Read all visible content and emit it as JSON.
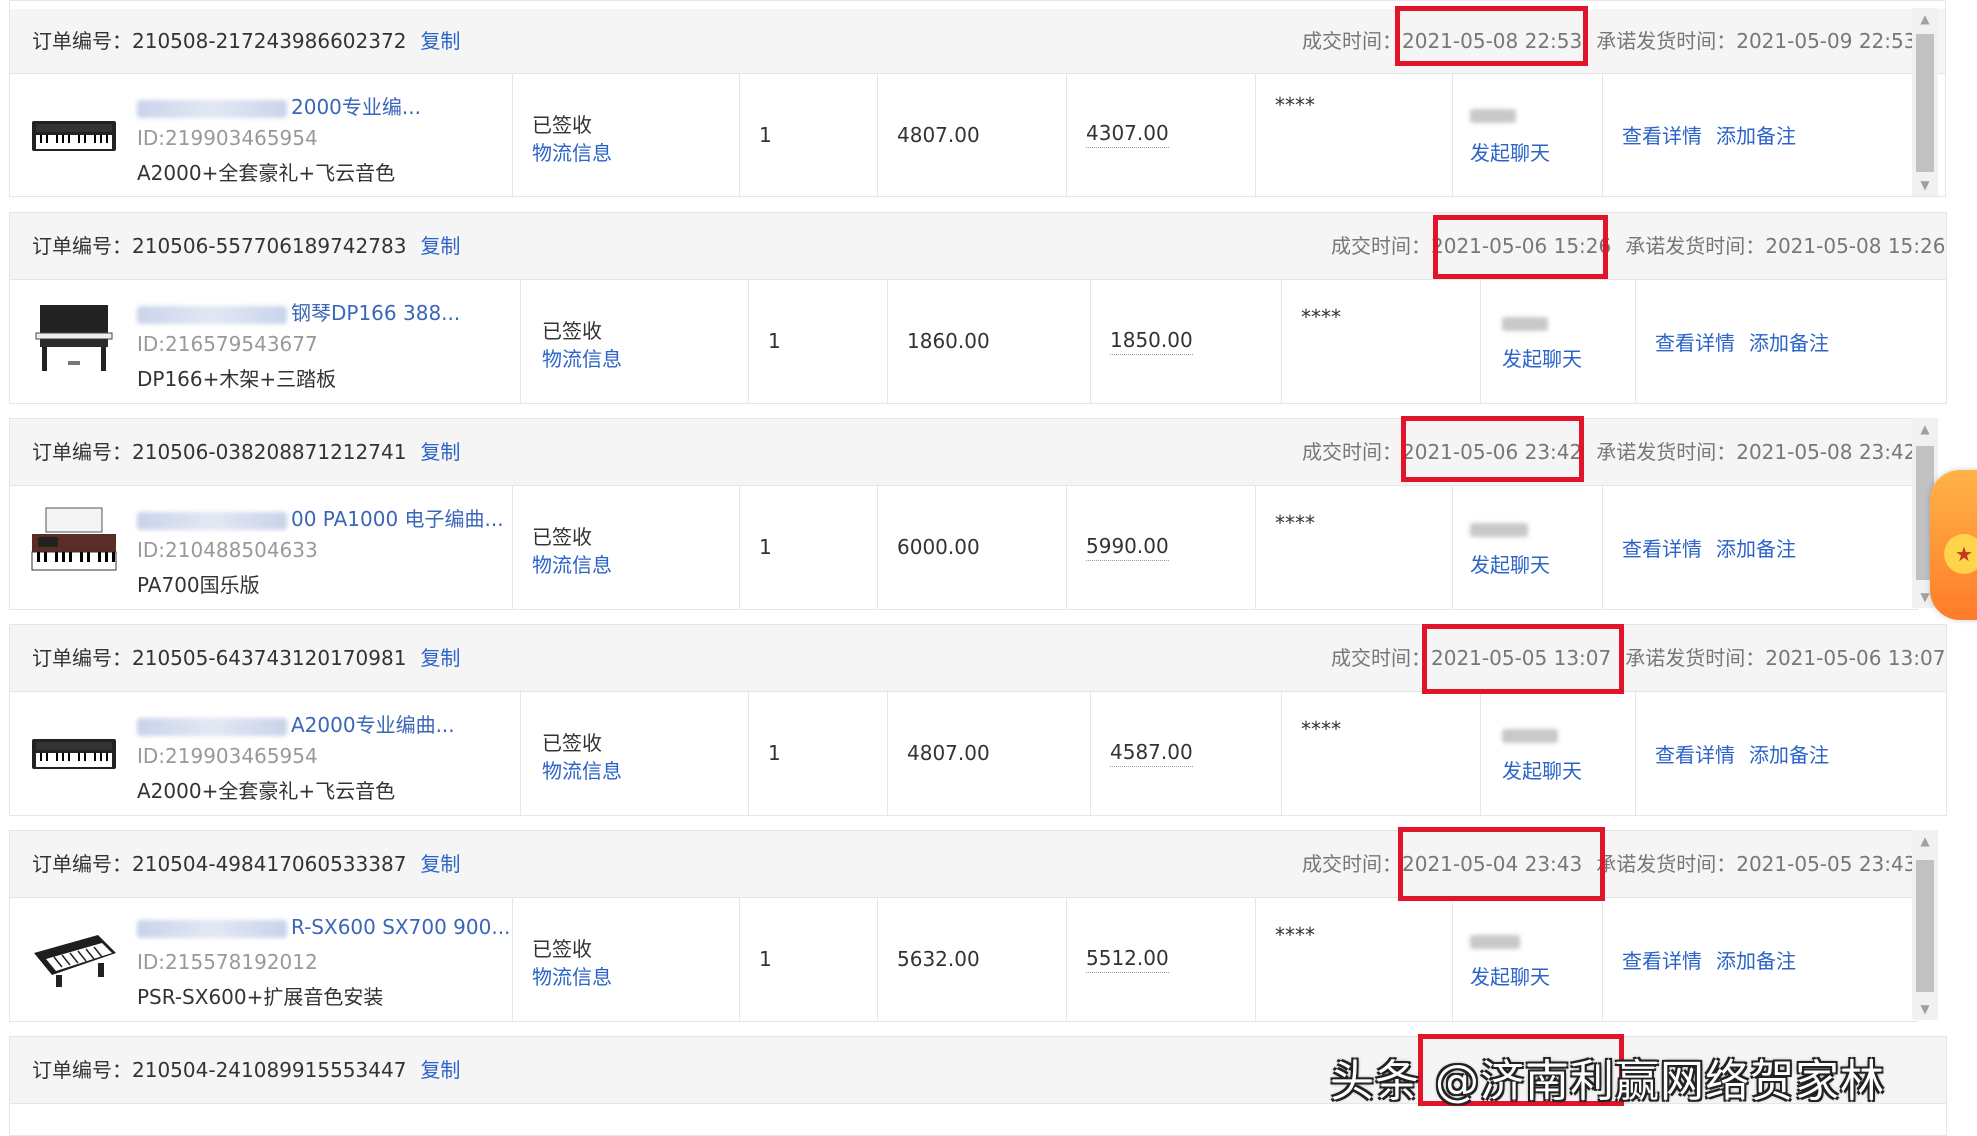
{
  "labels": {
    "order_no": "订单编号：",
    "copy": "复制",
    "deal_time": "成交时间：",
    "promise_time": "承诺发货时间：",
    "signed": "已签收",
    "logistics": "物流信息",
    "chat": "发起聊天",
    "details": "查看详情",
    "note": "添加备注",
    "masked": "****"
  },
  "orders": [
    {
      "order_no": "210508-217243986602372",
      "deal_time": "2021-05-08 22:53",
      "promise_time": "2021-05-09 22:53",
      "title": "2000专业编...",
      "item_id": "ID:219903465954",
      "spec": "A2000+全套豪礼+飞云音色",
      "qty": "1",
      "price": "4807.00",
      "paid": "4307.00"
    },
    {
      "order_no": "210506-557706189742783",
      "deal_time": "2021-05-06 15:26",
      "promise_time": "2021-05-08 15:26",
      "title": "钢琴DP166 388...",
      "item_id": "ID:216579543677",
      "spec": "DP166+木架+三踏板",
      "qty": "1",
      "price": "1860.00",
      "paid": "1850.00"
    },
    {
      "order_no": "210506-038208871212741",
      "deal_time": "2021-05-06 23:42",
      "promise_time": "2021-05-08 23:42",
      "title": "00 PA1000 电子编曲...",
      "item_id": "ID:210488504633",
      "spec": "PA700国乐版",
      "qty": "1",
      "price": "6000.00",
      "paid": "5990.00"
    },
    {
      "order_no": "210505-643743120170981",
      "deal_time": "2021-05-05 13:07",
      "promise_time": "2021-05-06 13:07",
      "title": "A2000专业编曲...",
      "item_id": "ID:219903465954",
      "spec": "A2000+全套豪礼+飞云音色",
      "qty": "1",
      "price": "4807.00",
      "paid": "4587.00"
    },
    {
      "order_no": "210504-498417060533387",
      "deal_time": "2021-05-04 23:43",
      "promise_time": "2021-05-05 23:43",
      "title": "R-SX600 SX700 900...",
      "item_id": "ID:215578192012",
      "spec": "PSR-SX600+扩展音色安装",
      "qty": "1",
      "price": "5632.00",
      "paid": "5512.00"
    },
    {
      "order_no": "210504-241089915553447"
    }
  ],
  "watermark": "头条 @济南利赢网络贺家林",
  "colors": {
    "link": "#2b63c8",
    "highlight": "#e0142b",
    "header_bg": "#f5f5f5"
  },
  "icons": [
    "keyboard-icon",
    "digital-piano-icon",
    "arranger-keyboard-icon",
    "portable-keyboard-icon"
  ]
}
